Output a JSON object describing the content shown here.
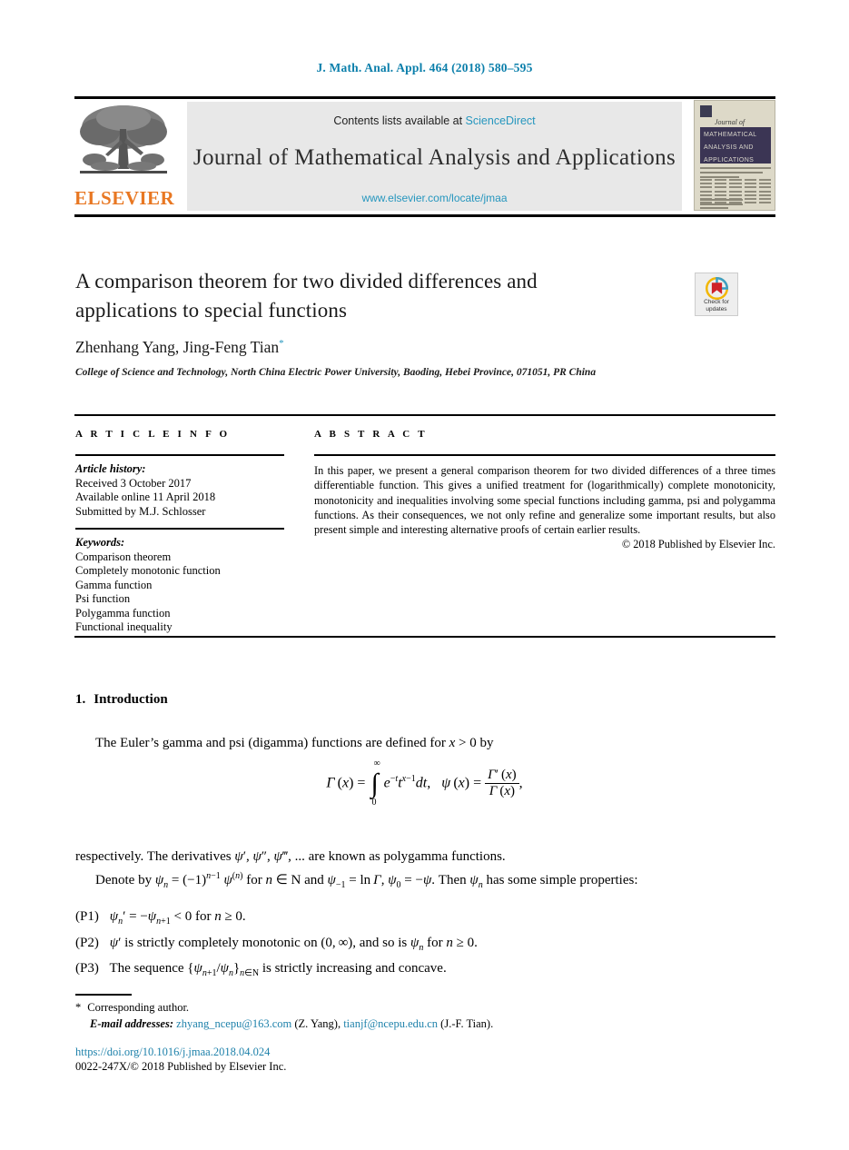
{
  "running_head": "J. Math. Anal. Appl. 464 (2018) 580–595",
  "masthead": {
    "contents_prefix": "Contents lists available at ",
    "sciencedirect": "ScienceDirect",
    "journal_title": "Journal of Mathematical Analysis and Applications",
    "journal_url": "www.elsevier.com/locate/jmaa",
    "publisher_logo_text": "ELSEVIER",
    "cover": {
      "journal_of": "Journal of",
      "line1": "MATHEMATICAL",
      "line2": "ANALYSIS AND",
      "line3": "APPLICATIONS"
    },
    "accent_link_color": "#2596be",
    "logo_color": "#E87722"
  },
  "article": {
    "title": "A comparison theorem for two divided differences and applications to special functions",
    "authors": "Zhenhang Yang, Jing-Feng Tian",
    "author_marker": "*",
    "affiliation": "College of Science and Technology, North China Electric Power University, Baoding, Hebei Province, 071051, PR China",
    "crossmark": {
      "line1": "Check for",
      "line2": "updates"
    }
  },
  "info": {
    "heading": "A R T I C L E   I N F O",
    "history_label": "Article history:",
    "history": [
      "Received 3 October 2017",
      "Available online 11 April 2018",
      "Submitted by M.J. Schlosser"
    ],
    "keywords_label": "Keywords:",
    "keywords": [
      "Comparison theorem",
      "Completely monotonic function",
      "Gamma function",
      "Psi function",
      "Polygamma function",
      "Functional inequality"
    ]
  },
  "abstract": {
    "heading": "A B S T R A C T",
    "text": "In this paper, we present a general comparison theorem for two divided differences of a three times differentiable function. This gives a unified treatment for (logarithmically) complete monotonicity, monotonicity and inequalities involving some special functions including gamma, psi and polygamma functions. As their consequences, we not only refine and generalize some important results, but also present simple and interesting alternative proofs of certain earlier results.",
    "copyright": "© 2018 Published by Elsevier Inc."
  },
  "body": {
    "section_number": "1.",
    "section_title": "Introduction",
    "paragraph_1": "The Euler’s gamma and psi (digamma) functions are defined for x > 0 by",
    "paragraph_2_line1": "respectively. The derivatives ψ′, ψ″, ψ‴, ... are known as polygamma functions.",
    "paragraph_2_line2": "Denote by ψₙ = (−1)ⁿ⁻¹ ψ⁽ⁿ⁾ for n ∈ N and ψ₋₁ = ln Γ, ψ₀ = −ψ. Then ψₙ has some simple properties:",
    "properties": [
      {
        "tag": "(P1)",
        "text": "ψₙ′ = −ψₙ₊₁ < 0 for n ≥ 0."
      },
      {
        "tag": "(P2)",
        "text": "ψ′ is strictly completely monotonic on (0, ∞), and so is ψₙ for n ≥ 0."
      },
      {
        "tag": "(P3)",
        "text": "The sequence {ψₙ₊₁/ψₙ}ₙ∈N is strictly increasing and concave."
      }
    ]
  },
  "footnotes": {
    "corresponding_marker": "*",
    "corresponding_text": "Corresponding author.",
    "email_label": "E-mail addresses:",
    "email_1": "zhyang_ncepu@163.com",
    "email_1_name": "(Z. Yang),",
    "email_2": "tianjf@ncepu.edu.cn",
    "email_2_name": "(J.-F. Tian).",
    "doi": "https://doi.org/10.1016/j.jmaa.2018.04.024",
    "issn_line": "0022-247X/© 2018 Published by Elsevier Inc."
  }
}
